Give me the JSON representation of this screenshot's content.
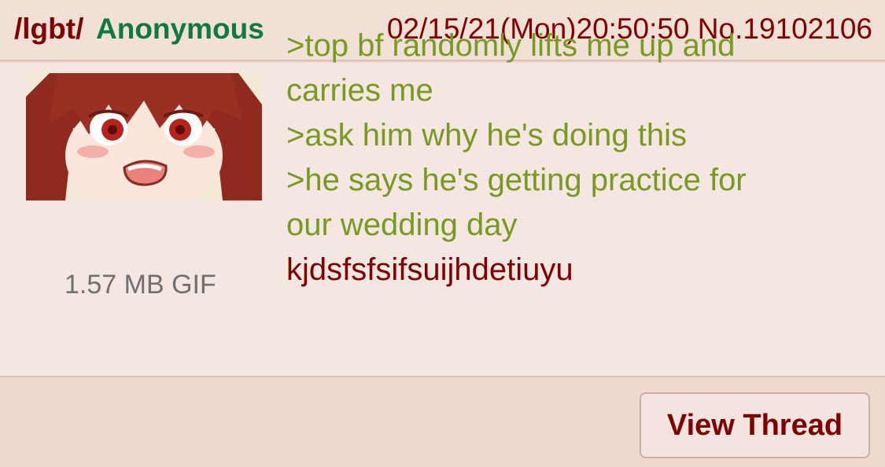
{
  "header": {
    "board": "/lgbt/",
    "name": "Anonymous",
    "meta": "02/15/21(Mon)20:50:50 No.19102106"
  },
  "post": {
    "file_info": "1.57 MB GIF",
    "greentext_lines": [
      ">top bf randomly lifts me up and",
      "carries me",
      ">ask him why he's doing this",
      ">he says he's getting practice for",
      "our wedding day"
    ],
    "plain_line": "kjdsfsfsifsuijhdetiuyu",
    "thumbnail_icon": "anime-girl-thumbnail"
  },
  "footer": {
    "view_thread_label": "View Thread"
  },
  "colors": {
    "board": "#800000",
    "name": "#117743",
    "greentext": "#789922",
    "background": "#f0e0d6"
  }
}
